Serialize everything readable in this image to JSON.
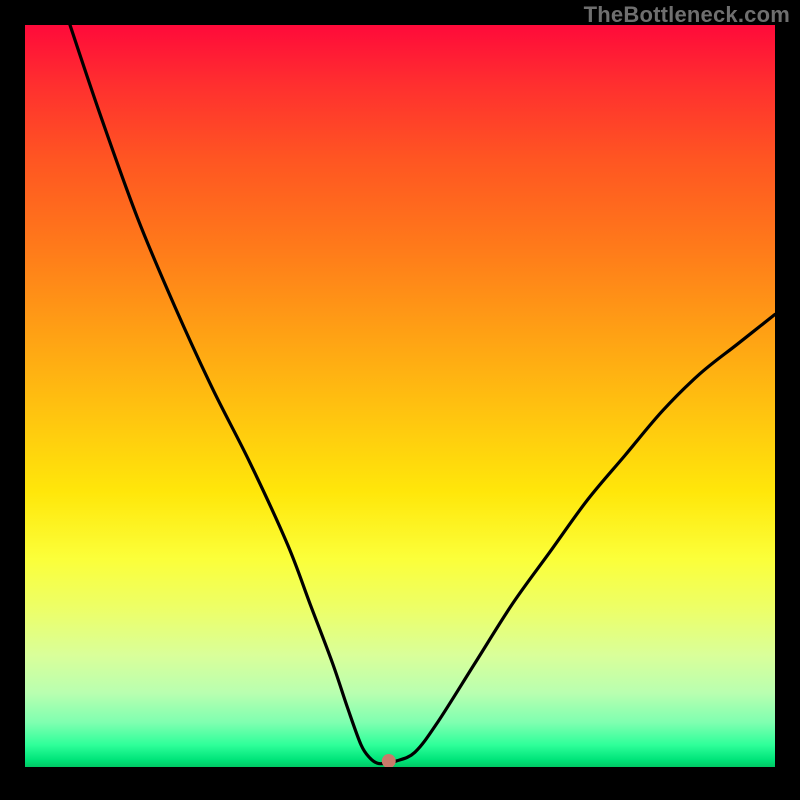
{
  "watermark": "TheBottleneck.com",
  "chart_data": {
    "type": "line",
    "title": "",
    "xlabel": "",
    "ylabel": "",
    "xlim": [
      0,
      100
    ],
    "ylim": [
      0,
      100
    ],
    "grid": false,
    "series": [
      {
        "name": "curve",
        "x": [
          6,
          10,
          15,
          20,
          25,
          30,
          35,
          38,
          41,
          43,
          44.8,
          46,
          47,
          48,
          49.5,
          52,
          55,
          60,
          65,
          70,
          75,
          80,
          85,
          90,
          95,
          100
        ],
        "y": [
          100,
          88,
          74,
          62,
          51,
          41,
          30,
          22,
          14,
          8,
          3,
          1.2,
          0.5,
          0.5,
          0.8,
          2,
          6,
          14,
          22,
          29,
          36,
          42,
          48,
          53,
          57,
          61
        ]
      }
    ],
    "marker": {
      "x": 48.5,
      "y": 0.8,
      "color": "#c97a6a"
    },
    "gradient_stops": [
      {
        "pos": 0,
        "color": "#ff0a3a"
      },
      {
        "pos": 8,
        "color": "#ff2f2f"
      },
      {
        "pos": 18,
        "color": "#ff5522"
      },
      {
        "pos": 30,
        "color": "#ff7a1a"
      },
      {
        "pos": 42,
        "color": "#ffa214"
      },
      {
        "pos": 53,
        "color": "#ffc60f"
      },
      {
        "pos": 63,
        "color": "#ffe70a"
      },
      {
        "pos": 72,
        "color": "#fbff3a"
      },
      {
        "pos": 79,
        "color": "#ecff6a"
      },
      {
        "pos": 85,
        "color": "#d9ff9a"
      },
      {
        "pos": 90,
        "color": "#b9ffb0"
      },
      {
        "pos": 94,
        "color": "#7fffb0"
      },
      {
        "pos": 97,
        "color": "#2fff9a"
      },
      {
        "pos": 99,
        "color": "#00e57a"
      },
      {
        "pos": 100,
        "color": "#00c864"
      }
    ]
  }
}
